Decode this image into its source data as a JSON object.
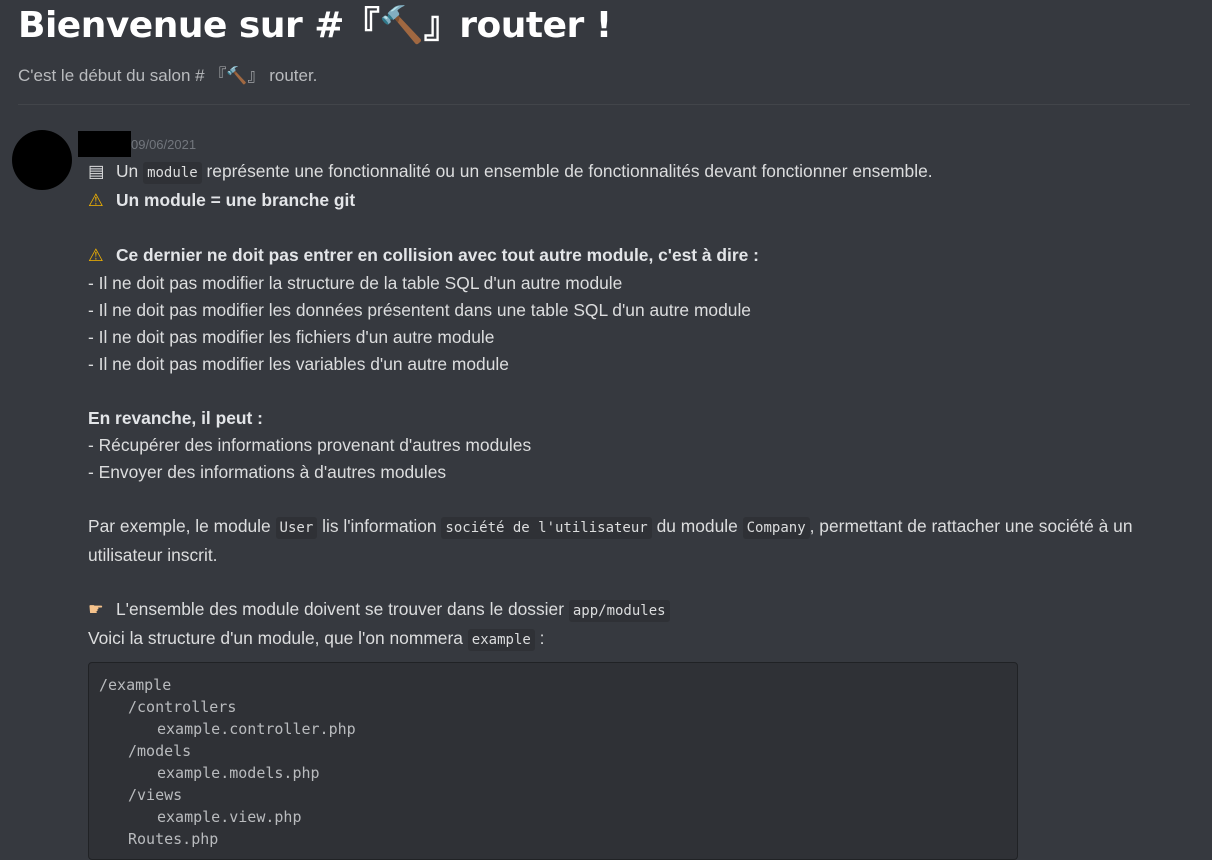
{
  "header": {
    "title": "Bienvenue sur #『🔨』router !",
    "subtitle": "C'est le début du salon # 『🔨』 router."
  },
  "message": {
    "timestamp": "09/06/2021",
    "icons": {
      "floppy": "floppy-disk-icon",
      "warning": "warning-icon",
      "point": "pointing-hand-icon"
    },
    "l1_pre": "Un",
    "l1_code": "module",
    "l1_post": "représente une fonctionnalité ou un ensemble de fonctionnalités devant fonctionner ensemble.",
    "l2": "Un module = une branche git",
    "l3": "Ce dernier ne doit pas entrer en collision avec tout autre module, c'est à dire :",
    "rules": [
      "- Il ne doit pas modifier la structure de la table SQL d'un autre module",
      "- Il ne doit pas modifier les données présentent dans une table SQL d'un autre module",
      "- Il ne doit pas modifier les fichiers d'un autre module",
      "- Il ne doit pas modifier les variables d'un autre module"
    ],
    "allowed_title": "En revanche, il peut :",
    "allowed": [
      "- Récupérer des informations provenant d'autres modules",
      "- Envoyer des informations à d'autres modules"
    ],
    "example_p1": "Par exemple, le module",
    "example_code1": "User",
    "example_p2": "lis l'information",
    "example_code2": "société de l'utilisateur",
    "example_p3": "du module",
    "example_code3": "Company",
    "example_p4": ", permettant de rattacher une société à un utilisateur inscrit.",
    "folder_pre": "L'ensemble des module doivent se trouver dans le dossier",
    "folder_code": "app/modules",
    "structure_pre": "Voici la structure d'un module, que l'on nommera",
    "structure_code": "example",
    "structure_post": ":",
    "tree": [
      "/example",
      "/controllers",
      "example.controller.php",
      "/models",
      "example.models.php",
      "/views",
      "example.view.php",
      "Routes.php"
    ]
  }
}
